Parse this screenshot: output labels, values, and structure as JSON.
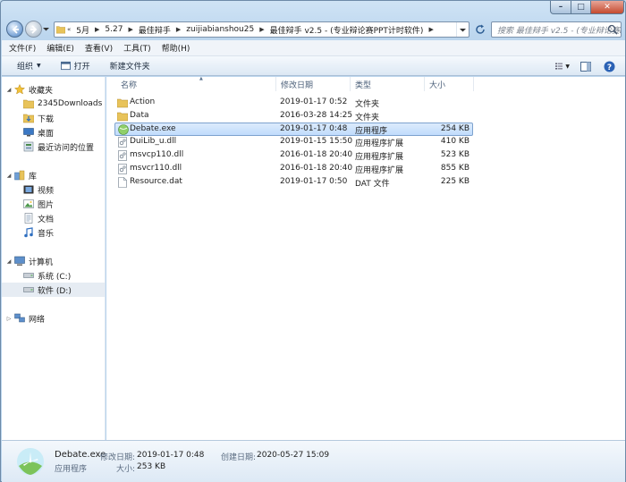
{
  "address": {
    "crumbs": [
      "5月",
      "5.27",
      "最佳辩手",
      "zuijiabianshou25",
      "最佳辩手 v2.5 - (专业辩论赛PPT计时软件)"
    ]
  },
  "search": {
    "placeholder": "搜索 最佳辩手 v2.5 - (专业辩论赛PP..."
  },
  "menu": [
    "文件(F)",
    "编辑(E)",
    "查看(V)",
    "工具(T)",
    "帮助(H)"
  ],
  "toolbar": {
    "organize": "组织",
    "open": "打开",
    "new_folder": "新建文件夹"
  },
  "nav": {
    "favorites": "收藏夹",
    "fav_items": [
      "2345Downloads",
      "下载",
      "桌面",
      "最近访问的位置"
    ],
    "libraries": "库",
    "lib_items": [
      "视频",
      "图片",
      "文档",
      "音乐"
    ],
    "computer": "计算机",
    "drives": [
      "系统 (C:)",
      "软件 (D:)"
    ],
    "network": "网络"
  },
  "columns": {
    "name": "名称",
    "date": "修改日期",
    "type": "类型",
    "size": "大小"
  },
  "files": [
    {
      "name": "Action",
      "date": "2019-01-17 0:52",
      "type": "文件夹",
      "size": "",
      "icon": "folder-icon"
    },
    {
      "name": "Data",
      "date": "2016-03-28 14:25",
      "type": "文件夹",
      "size": "",
      "icon": "folder-icon"
    },
    {
      "name": "Debate.exe",
      "date": "2019-01-17 0:48",
      "type": "应用程序",
      "size": "254 KB",
      "icon": "exe-icon"
    },
    {
      "name": "DuiLib_u.dll",
      "date": "2019-01-15 15:50",
      "type": "应用程序扩展",
      "size": "410 KB",
      "icon": "dll-icon"
    },
    {
      "name": "msvcp110.dll",
      "date": "2016-01-18 20:40",
      "type": "应用程序扩展",
      "size": "523 KB",
      "icon": "dll-icon"
    },
    {
      "name": "msvcr110.dll",
      "date": "2016-01-18 20:40",
      "type": "应用程序扩展",
      "size": "855 KB",
      "icon": "dll-icon"
    },
    {
      "name": "Resource.dat",
      "date": "2019-01-17 0:50",
      "type": "DAT 文件",
      "size": "225 KB",
      "icon": "file-icon"
    }
  ],
  "details": {
    "name": "Debate.exe",
    "modified_label": "修改日期:",
    "modified": "2019-01-17 0:48",
    "created_label": "创建日期:",
    "created": "2020-05-27 15:09",
    "type": "应用程序",
    "size_label": "大小:",
    "size": "253 KB"
  },
  "colors": {
    "selection": "#c1dcfc",
    "selection_border": "#7da2ce",
    "window": "#bcd6ee",
    "folder": "#e8c35a"
  }
}
